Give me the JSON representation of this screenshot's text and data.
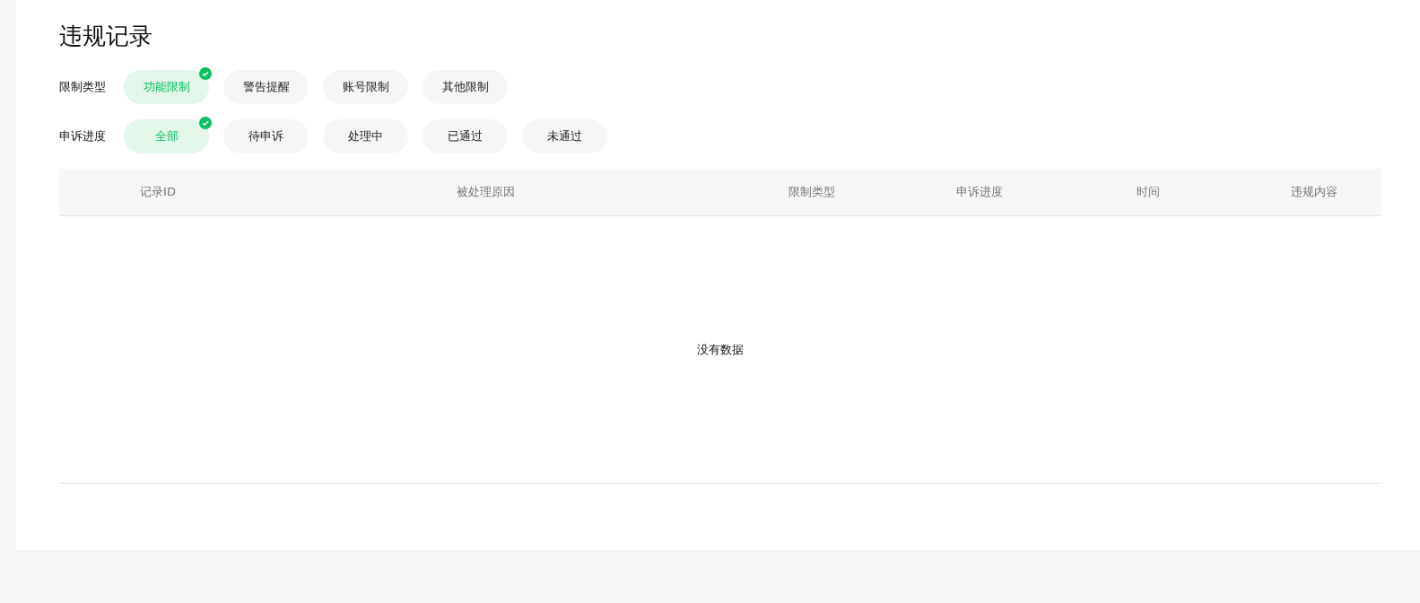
{
  "title": "违规记录",
  "filters": [
    {
      "label": "限制类型",
      "options": [
        {
          "label": "功能限制",
          "selected": true
        },
        {
          "label": "警告提醒",
          "selected": false
        },
        {
          "label": "账号限制",
          "selected": false
        },
        {
          "label": "其他限制",
          "selected": false
        }
      ]
    },
    {
      "label": "申诉进度",
      "options": [
        {
          "label": "全部",
          "selected": true
        },
        {
          "label": "待申诉",
          "selected": false
        },
        {
          "label": "处理中",
          "selected": false
        },
        {
          "label": "已通过",
          "selected": false
        },
        {
          "label": "未通过",
          "selected": false
        }
      ]
    }
  ],
  "table": {
    "columns": [
      "记录ID",
      "被处理原因",
      "限制类型",
      "申诉进度",
      "时间",
      "违规内容"
    ],
    "empty_text": "没有数据"
  }
}
